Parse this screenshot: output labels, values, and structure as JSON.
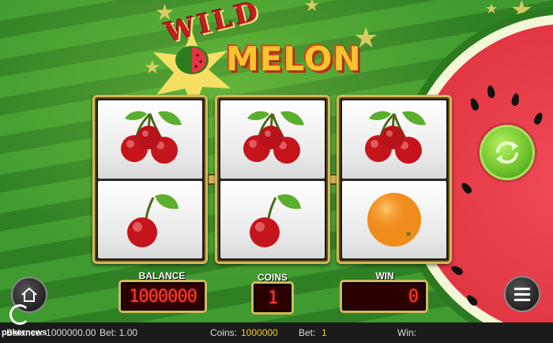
{
  "game": {
    "title_line1": "WILD",
    "title_line2": "MELON"
  },
  "reels": [
    {
      "top": "cherries",
      "bottom": "cherry"
    },
    {
      "top": "cherries",
      "bottom": "cherry"
    },
    {
      "top": "cherries",
      "bottom": "orange"
    }
  ],
  "counters": {
    "balance_label": "BALANCE",
    "balance_value": "1000000",
    "coins_label": "COINS",
    "coins_value": "1",
    "win_label": "WIN",
    "win_value": "0"
  },
  "bottom_bar": {
    "balance_text": "Balance: 1000000.00",
    "bet_text": "Bet: 1.00",
    "coins_label": "Coins:",
    "coins_value": "1000000",
    "bet_label": "Bet:",
    "bet_value": "1",
    "win_label": "Win:"
  },
  "watermark": {
    "brand": "pokernews"
  },
  "icons": {
    "spin": "spin-arrows-icon",
    "home": "home-icon",
    "menu": "hamburger-menu-icon"
  },
  "colors": {
    "accent_gold": "#d7b75a",
    "counter_red": "#ff3b2c",
    "spin_green": "#6cc12a",
    "bottom_yellow": "#f4d000"
  }
}
